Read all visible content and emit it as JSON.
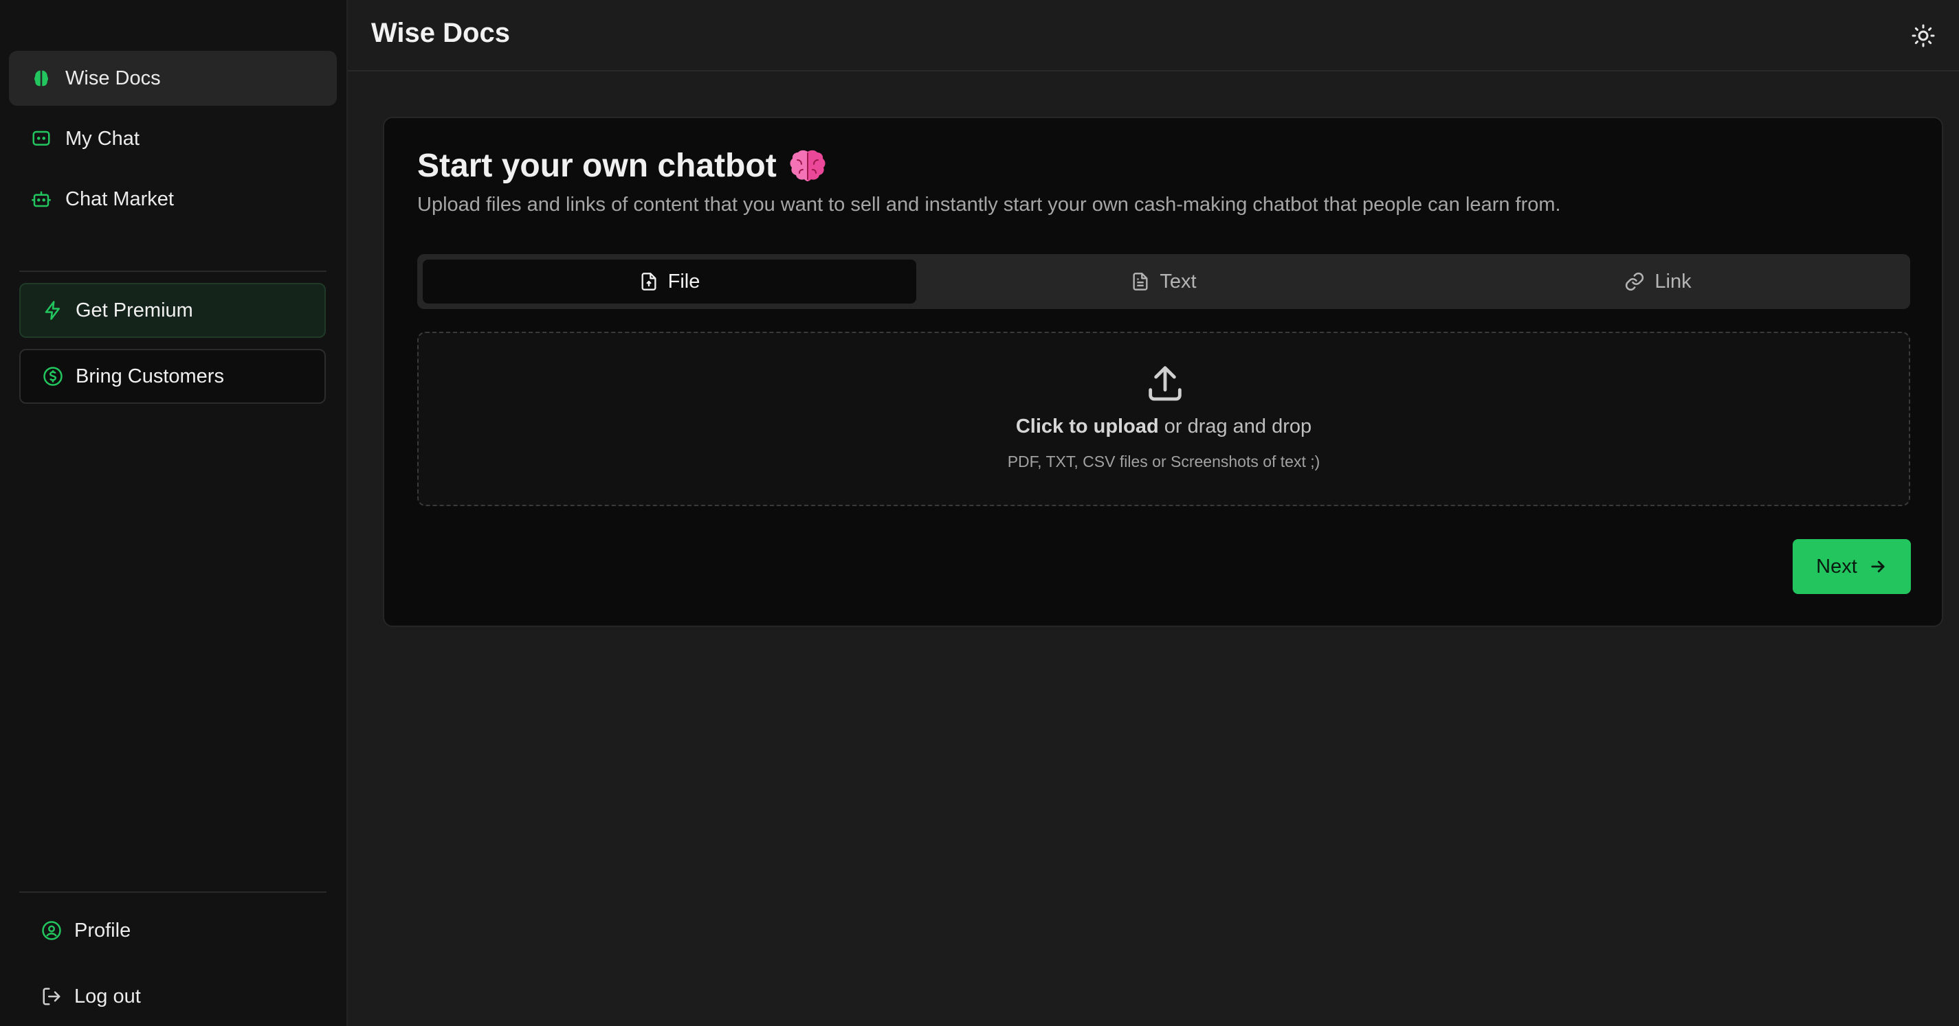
{
  "colors": {
    "accent": "#22c55e",
    "sidebar_bg": "#121212",
    "main_bg": "#1c1c1c",
    "card_bg": "#0b0b0c"
  },
  "sidebar": {
    "nav": [
      {
        "label": "Wise Docs",
        "icon": "brain-icon",
        "active": true
      },
      {
        "label": "My Chat",
        "icon": "chat-bubble-icon",
        "active": false
      },
      {
        "label": "Chat Market",
        "icon": "bot-icon",
        "active": false
      }
    ],
    "cta": [
      {
        "label": "Get Premium",
        "icon": "lightning-icon"
      },
      {
        "label": "Bring Customers",
        "icon": "dollar-circle-icon"
      }
    ],
    "footer": [
      {
        "label": "Profile",
        "icon": "user-circle-icon"
      },
      {
        "label": "Log out",
        "icon": "logout-icon"
      }
    ]
  },
  "header": {
    "title": "Wise Docs",
    "theme_icon": "sun-icon"
  },
  "card": {
    "title": "Start your own chatbot",
    "title_emoji": "brain-emoji",
    "subtitle": "Upload files and links of content that you want to sell and instantly start your own cash-making chatbot that people can learn from.",
    "tabs": [
      {
        "label": "File",
        "icon": "file-upload-icon",
        "active": true
      },
      {
        "label": "Text",
        "icon": "document-icon",
        "active": false
      },
      {
        "label": "Link",
        "icon": "link-icon",
        "active": false
      }
    ],
    "dropzone": {
      "cta_bold": "Click to upload",
      "cta_rest": " or drag and drop",
      "hint": "PDF, TXT, CSV files or Screenshots of text ;)"
    },
    "next_label": "Next"
  }
}
